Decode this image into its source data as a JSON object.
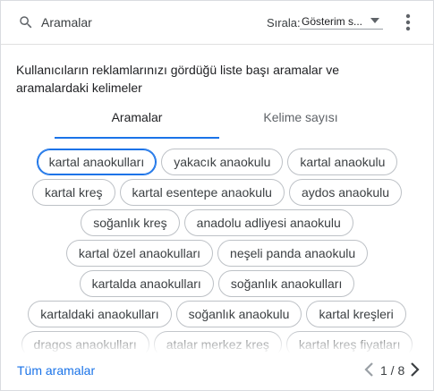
{
  "header": {
    "search_label": "Aramalar",
    "sort_label": "Sırala:",
    "sort_value": "Gösterim s..."
  },
  "description": "Kullanıcıların reklamlarınızı gördüğü liste başı aramalar ve aramalardaki kelimeler",
  "tabs": [
    {
      "label": "Aramalar",
      "active": true
    },
    {
      "label": "Kelime sayısı",
      "active": false
    }
  ],
  "chip_rows": [
    [
      "kartal anaokulları",
      "yakacık anaokulu",
      "kartal anaokulu"
    ],
    [
      "kartal kreş",
      "kartal esentepe anaokulu",
      "aydos anaokulu"
    ],
    [
      "soğanlık kreş",
      "anadolu adliyesi anaokulu"
    ],
    [
      "kartal özel anaokulları",
      "neşeli panda anaokulu"
    ],
    [
      "kartalda anaokulları",
      "soğanlık anaokulları"
    ],
    [
      "kartaldaki anaokulları",
      "soğanlık anaokulu",
      "kartal kreşleri"
    ],
    [
      "dragos anaokulları",
      "atalar merkez kreş",
      "kartal kreş fiyatları"
    ]
  ],
  "footer": {
    "all_label": "Tüm aramalar",
    "page_indicator": "1 / 8"
  },
  "colors": {
    "accent": "#1a73e8",
    "chip_border": "#bdc1c6",
    "text": "#202124"
  },
  "icons": [
    "search-icon",
    "more-vert-icon",
    "chevron-left-icon",
    "chevron-right-icon"
  ]
}
